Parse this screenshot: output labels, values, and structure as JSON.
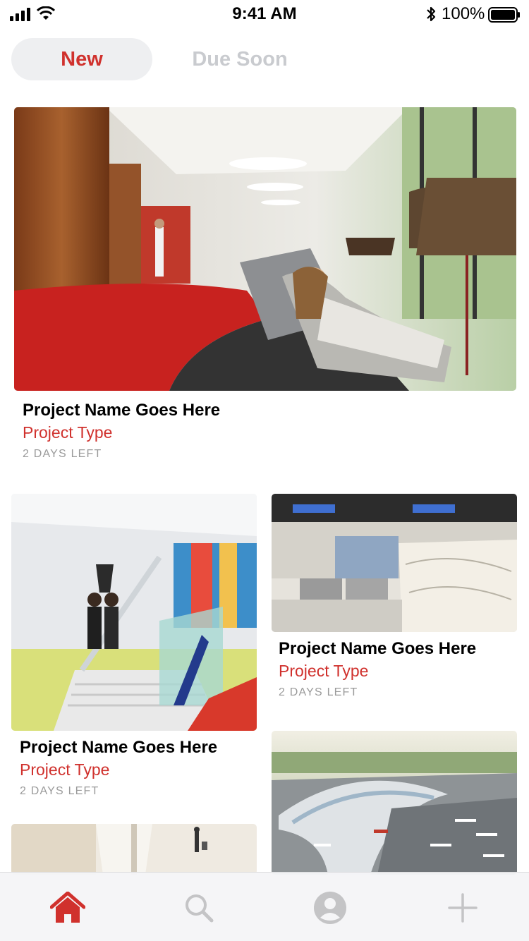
{
  "status_bar": {
    "time": "9:41 AM",
    "battery": "100%",
    "icons": [
      "signal-icon",
      "wifi-icon",
      "bluetooth-icon",
      "battery-icon"
    ]
  },
  "tabs": [
    {
      "label": "New",
      "active": true
    },
    {
      "label": "Due Soon",
      "active": false
    }
  ],
  "projects": [
    {
      "title": "Project Name Goes Here",
      "type": "Project Type",
      "due": "2 DAYS LEFT"
    },
    {
      "title": "Project Name Goes Here",
      "type": "Project Type",
      "due": "2 DAYS LEFT"
    },
    {
      "title": "Project Name Goes Here",
      "type": "Project Type",
      "due": "2 DAYS LEFT"
    }
  ],
  "bottom_nav": [
    {
      "icon": "home-icon",
      "active": true
    },
    {
      "icon": "search-icon",
      "active": false
    },
    {
      "icon": "profile-icon",
      "active": false
    },
    {
      "icon": "add-icon",
      "active": false
    }
  ],
  "colors": {
    "accent": "#d0312d",
    "inactive_tab_text": "#c9cbcf",
    "muted_text": "#9a9a9a",
    "icon_inactive": "#c4c4c6"
  }
}
